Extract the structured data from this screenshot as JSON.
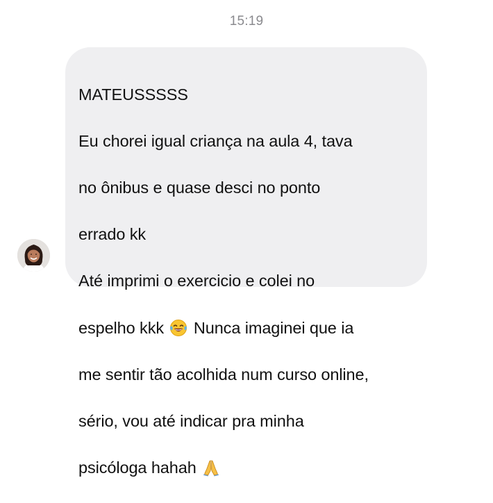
{
  "header": {
    "time": "15:19"
  },
  "contact": {
    "avatar_icon": "avatar-icon"
  },
  "message": {
    "lines": [
      "MATEUSSSSS",
      "Eu chorei igual criança na aula 4, tava",
      "no ônibus e quase desci no ponto",
      "errado kk",
      "Até imprimi o exercicio e colei no",
      "espelho kkk",
      " Nunca imaginei que ia",
      "me sentir tão acolhida num curso online,",
      "sério, vou até indicar pra minha",
      "psicóloga hahah"
    ],
    "emoji_1": "😂",
    "emoji_2": "🙏"
  },
  "colors": {
    "bubble_bg": "#efeff1",
    "text": "#111111",
    "timestamp": "#8a8a8e"
  }
}
